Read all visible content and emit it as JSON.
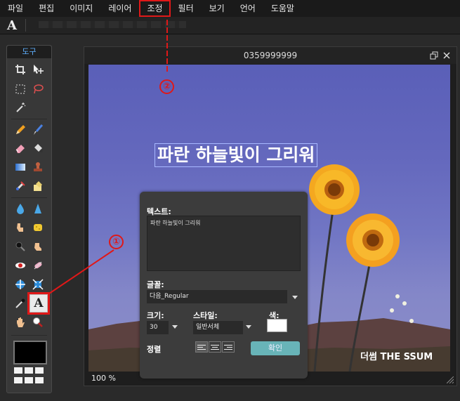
{
  "menu": {
    "items": [
      "파일",
      "편집",
      "이미지",
      "레이어",
      "조정",
      "필터",
      "보기",
      "언어",
      "도움말"
    ]
  },
  "options": {
    "tool_glyph": "A"
  },
  "toolbox": {
    "title": "도구",
    "text_tool_glyph": "A",
    "icons": [
      "crop-icon",
      "move-icon",
      "marquee-icon",
      "lasso-icon",
      "magic-wand-icon",
      "pencil-icon",
      "brush-icon",
      "eraser-icon",
      "bucket-icon",
      "gradient-icon",
      "stamp-icon",
      "color-replace-icon",
      "drawing-icon",
      "blur-icon",
      "sharpen-icon",
      "smudge-icon",
      "sponge-icon",
      "dodge-icon",
      "burn-icon",
      "red-eye-icon",
      "spot-heal-icon",
      "bloat-icon",
      "pinch-icon",
      "color-picker-icon",
      "text-tool-icon",
      "hand-icon",
      "zoom-icon"
    ]
  },
  "canvas": {
    "title": "0359999999",
    "overlay_text": "파란 하늘빛이 그리워",
    "watermark": "더썸  THE SSUM",
    "zoom_value": "100",
    "zoom_unit": "%"
  },
  "text_panel": {
    "text_label": "텍스트:",
    "text_value": "파란 하늘빛이 그리워",
    "font_label": "글꼴:",
    "font_value": "다음_Regular",
    "size_label": "크기:",
    "size_value": "30",
    "style_label": "스타일:",
    "style_value": "일반서체",
    "color_label": "색:",
    "align_label": "정렬",
    "ok_label": "확인",
    "text_color": "#ffffff"
  },
  "annotations": {
    "marker1": "①",
    "marker2": "②",
    "color": "#e01818"
  }
}
